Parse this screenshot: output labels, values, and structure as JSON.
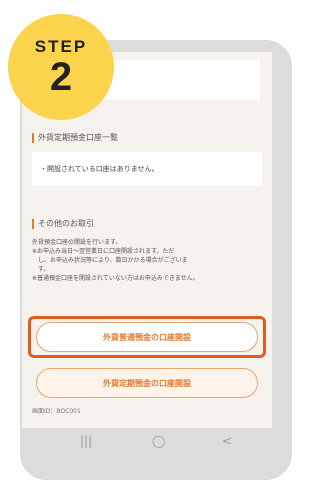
{
  "badge": {
    "step": "STEP",
    "number": "2"
  },
  "top_card": {
    "mark": "?"
  },
  "section1": {
    "title": "外貨定期預金口座一覧"
  },
  "list": {
    "empty_message": "・開設されている口座はありません。"
  },
  "section2": {
    "title": "その他のお取引"
  },
  "notes": [
    "外貨預金口座の開設を行います。",
    "※お申込み当日〜翌営業日に口座開設されます。ただ",
    "　し、お申込み状況等により、数日かかる場合がございま",
    "　す。",
    "※普通預金口座を開設されていない方はお申込みできません。"
  ],
  "buttons": {
    "ordinary": "外貨普通預金の口座開設",
    "time": "外貨定期預金の口座開設"
  },
  "screen_id": "画面ID：BOC001",
  "nav": {
    "recent": "|||",
    "home": "◯",
    "back": "<"
  },
  "colors": {
    "accent": "#e07a2e",
    "highlight": "#e25a1c",
    "badge": "#fcd34d"
  }
}
